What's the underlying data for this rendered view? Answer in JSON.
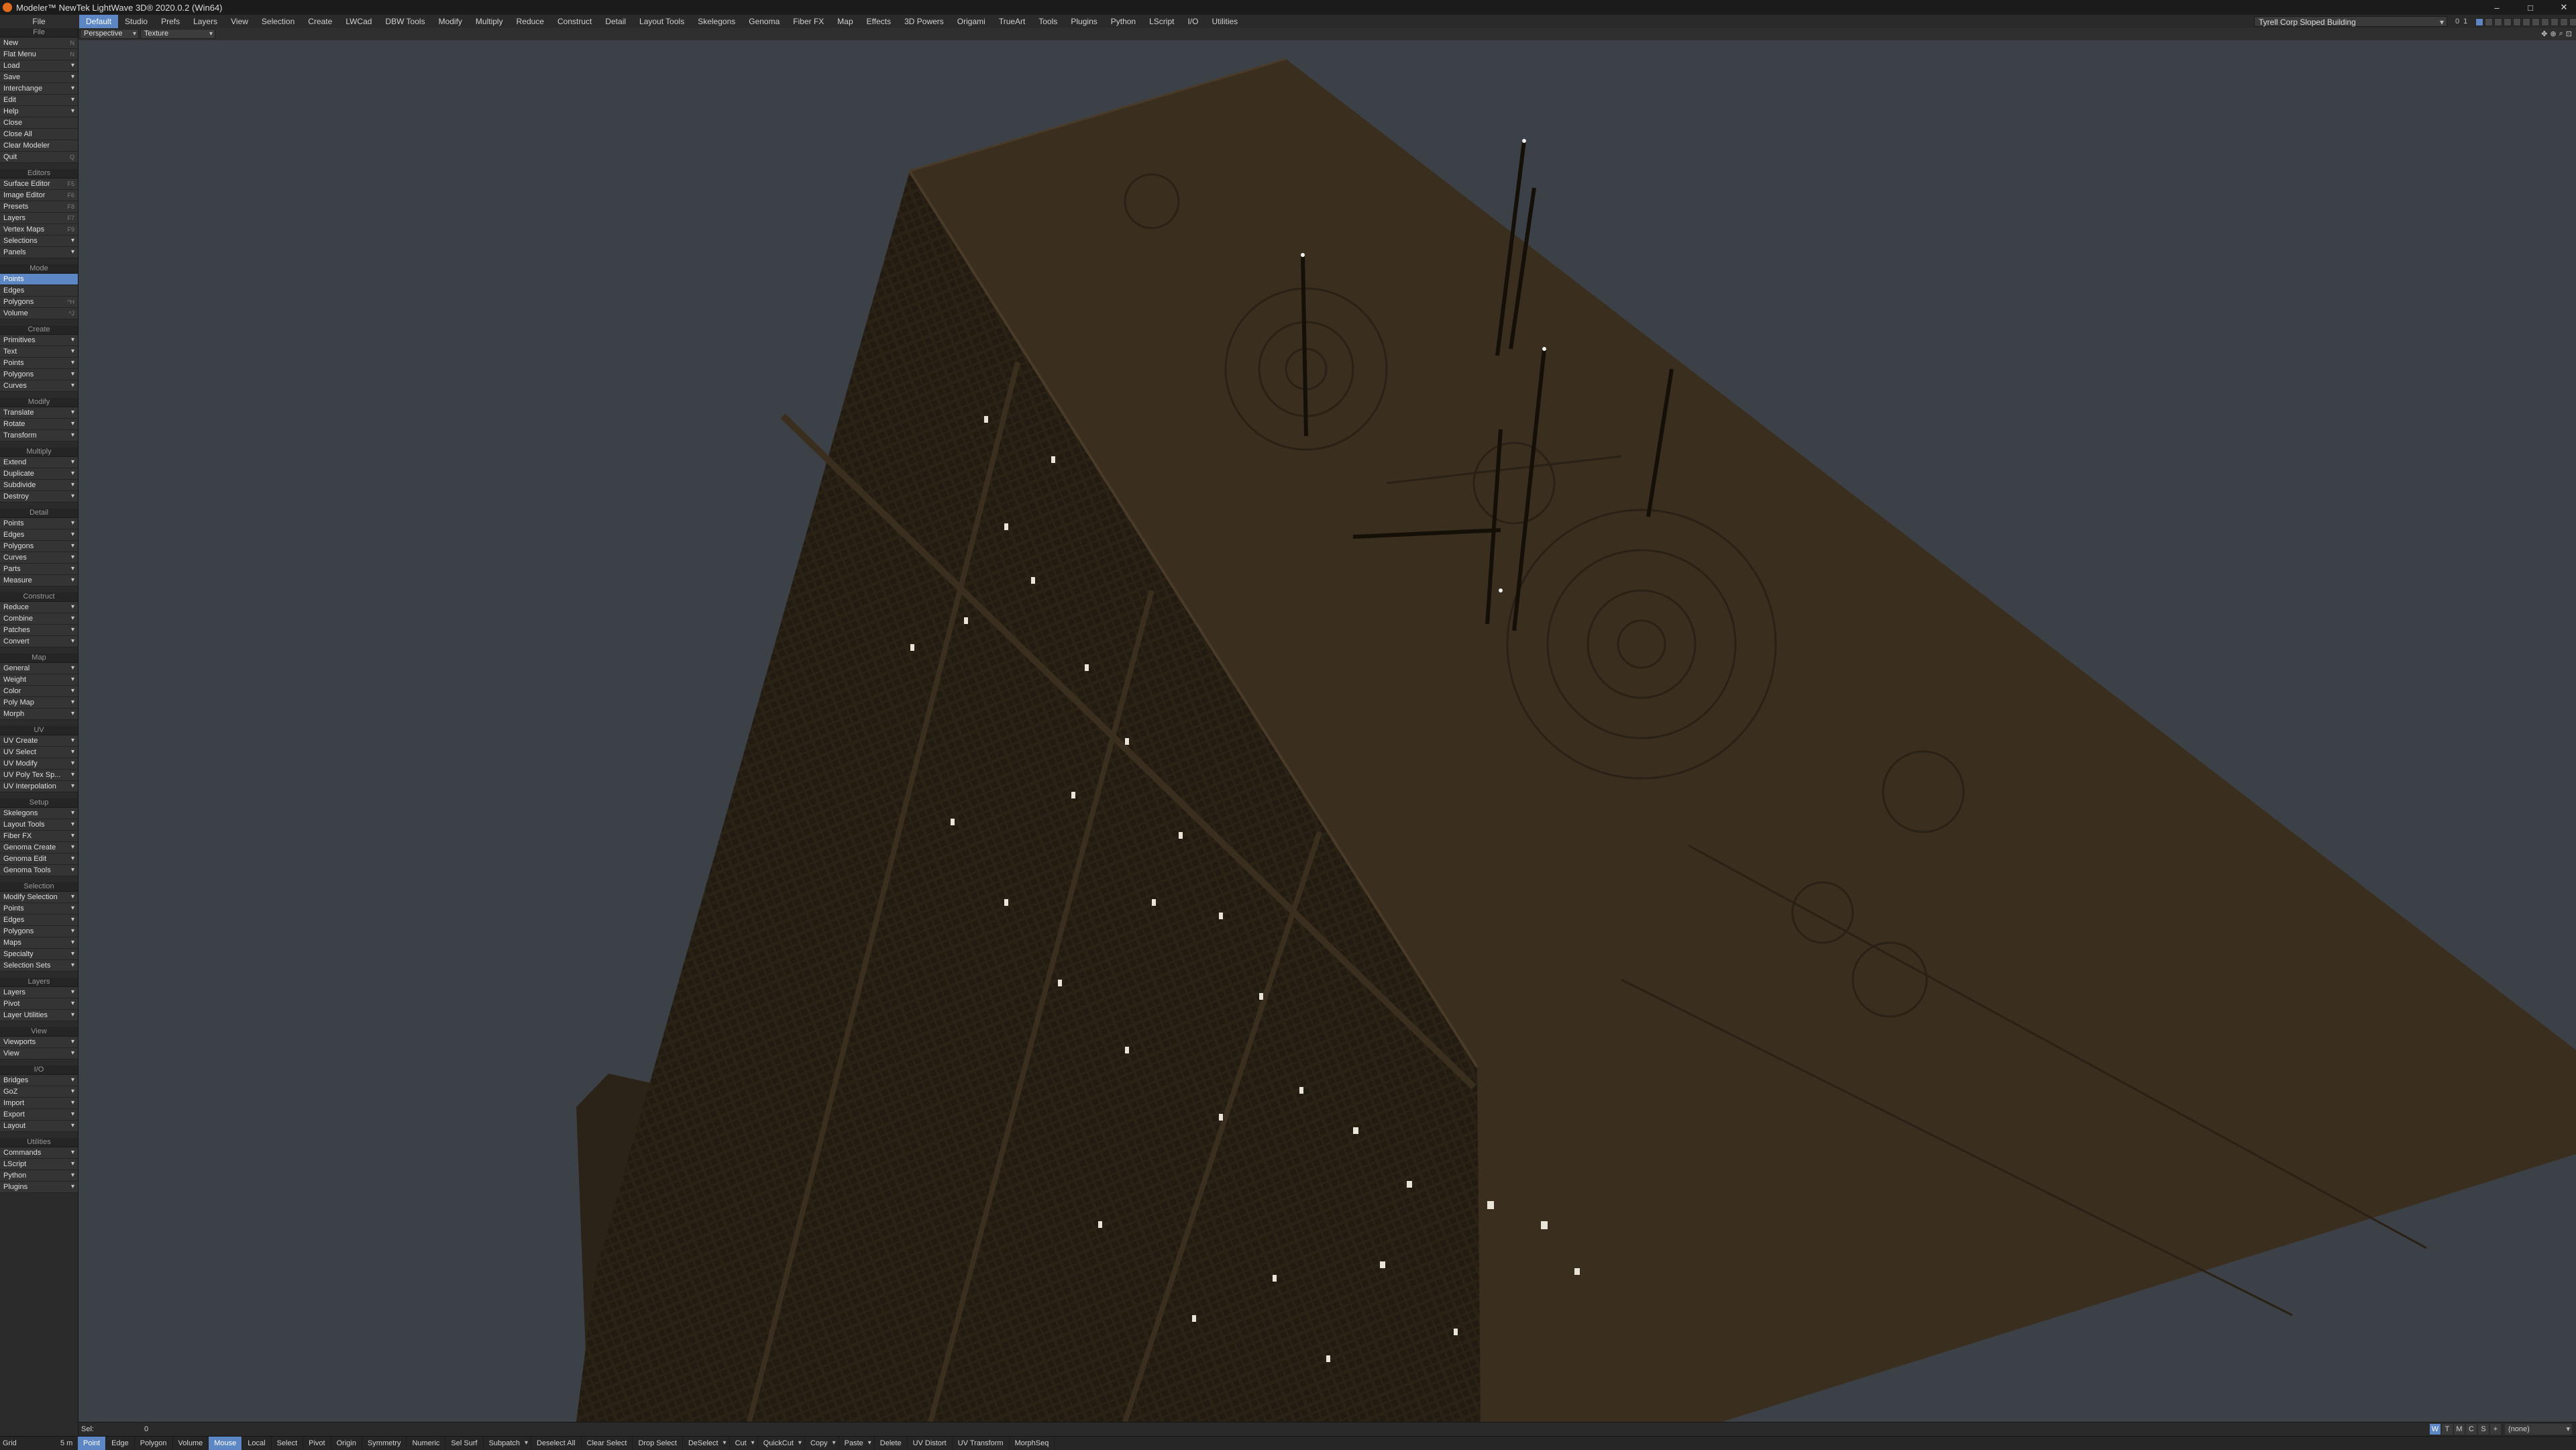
{
  "window": {
    "title": "Modeler™ NewTek LightWave 3D® 2020.0.2 (Win64)",
    "controls": [
      "–",
      "□",
      "✕"
    ]
  },
  "tabs": {
    "file_label": "File",
    "items": [
      "Default",
      "Studio",
      "Prefs",
      "Layers",
      "View",
      "Selection",
      "Create",
      "LWCad",
      "DBW Tools",
      "Modify",
      "Multiply",
      "Reduce",
      "Construct",
      "Detail",
      "Layout Tools",
      "Skelegons",
      "Genoma",
      "Fiber FX",
      "Map",
      "Effects",
      "3D Powers",
      "Origami",
      "TrueArt",
      "Tools",
      "Plugins",
      "Python",
      "LScript",
      "I/O",
      "Utilities"
    ],
    "active": "Default"
  },
  "object_selector": {
    "value": "Tyrell Corp Sloped Building"
  },
  "layer_info": {
    "a": "0",
    "b": "1"
  },
  "sidebar": {
    "file_group": [
      {
        "label": "New",
        "sc": "N"
      },
      {
        "label": "Flat Menu",
        "sc": "N"
      },
      {
        "label": "Load",
        "arrow": true
      },
      {
        "label": "Save",
        "arrow": true
      },
      {
        "label": "Interchange",
        "arrow": true
      },
      {
        "label": "Edit",
        "arrow": true
      },
      {
        "label": "Help",
        "arrow": true
      },
      {
        "label": "Close",
        "sc": ""
      },
      {
        "label": "Close All",
        "sc": ""
      },
      {
        "label": "Clear Modeler",
        "sc": ""
      },
      {
        "label": "Quit",
        "sc": "Q"
      }
    ],
    "groups": [
      {
        "title": "Editors",
        "items": [
          {
            "label": "Surface Editor",
            "sc": "F5"
          },
          {
            "label": "Image Editor",
            "sc": "F6"
          },
          {
            "label": "Presets",
            "sc": "F8"
          },
          {
            "label": "Layers",
            "sc": "F7"
          },
          {
            "label": "Vertex Maps",
            "sc": "F9"
          },
          {
            "label": "Selections",
            "arrow": true
          },
          {
            "label": "Panels",
            "arrow": true
          }
        ]
      },
      {
        "title": "Mode",
        "items": [
          {
            "label": "Points",
            "active": true
          },
          {
            "label": "Edges"
          },
          {
            "label": "Polygons",
            "sc": "^H"
          },
          {
            "label": "Volume",
            "sc": "^J"
          }
        ]
      },
      {
        "title": "Create",
        "items": [
          {
            "label": "Primitives",
            "arrow": true
          },
          {
            "label": "Text",
            "arrow": true
          },
          {
            "label": "Points",
            "arrow": true
          },
          {
            "label": "Polygons",
            "arrow": true
          },
          {
            "label": "Curves",
            "arrow": true
          }
        ]
      },
      {
        "title": "Modify",
        "items": [
          {
            "label": "Translate",
            "arrow": true
          },
          {
            "label": "Rotate",
            "arrow": true
          },
          {
            "label": "Transform",
            "arrow": true
          }
        ]
      },
      {
        "title": "Multiply",
        "items": [
          {
            "label": "Extend",
            "arrow": true
          },
          {
            "label": "Duplicate",
            "arrow": true
          },
          {
            "label": "Subdivide",
            "arrow": true
          },
          {
            "label": "Destroy",
            "arrow": true
          }
        ]
      },
      {
        "title": "Detail",
        "items": [
          {
            "label": "Points",
            "arrow": true
          },
          {
            "label": "Edges",
            "arrow": true
          },
          {
            "label": "Polygons",
            "arrow": true
          },
          {
            "label": "Curves",
            "arrow": true
          },
          {
            "label": "Parts",
            "arrow": true
          },
          {
            "label": "Measure",
            "arrow": true
          }
        ]
      },
      {
        "title": "Construct",
        "items": [
          {
            "label": "Reduce",
            "arrow": true
          },
          {
            "label": "Combine",
            "arrow": true
          },
          {
            "label": "Patches",
            "arrow": true
          },
          {
            "label": "Convert",
            "arrow": true
          }
        ]
      },
      {
        "title": "Map",
        "items": [
          {
            "label": "General",
            "arrow": true
          },
          {
            "label": "Weight",
            "arrow": true
          },
          {
            "label": "Color",
            "arrow": true
          },
          {
            "label": "Poly Map",
            "arrow": true
          },
          {
            "label": "Morph",
            "arrow": true
          }
        ]
      },
      {
        "title": "UV",
        "items": [
          {
            "label": "UV Create",
            "arrow": true
          },
          {
            "label": "UV Select",
            "arrow": true
          },
          {
            "label": "UV Modify",
            "arrow": true
          },
          {
            "label": "UV Poly Tex Sp...",
            "arrow": true
          },
          {
            "label": "UV Interpolation",
            "arrow": true
          }
        ]
      },
      {
        "title": "Setup",
        "items": [
          {
            "label": "Skelegons",
            "arrow": true
          },
          {
            "label": "Layout Tools",
            "arrow": true
          },
          {
            "label": "Fiber FX",
            "arrow": true
          },
          {
            "label": "Genoma Create",
            "arrow": true
          },
          {
            "label": "Genoma Edit",
            "arrow": true
          },
          {
            "label": "Genoma Tools",
            "arrow": true
          }
        ]
      },
      {
        "title": "Selection",
        "items": [
          {
            "label": "Modify Selection",
            "arrow": true
          },
          {
            "label": "Points",
            "arrow": true
          },
          {
            "label": "Edges",
            "arrow": true
          },
          {
            "label": "Polygons",
            "arrow": true
          },
          {
            "label": "Maps",
            "arrow": true
          },
          {
            "label": "Specialty",
            "arrow": true
          },
          {
            "label": "Selection Sets",
            "arrow": true
          }
        ]
      },
      {
        "title": "Layers",
        "items": [
          {
            "label": "Layers",
            "arrow": true
          },
          {
            "label": "Pivot",
            "arrow": true
          },
          {
            "label": "Layer Utilities",
            "arrow": true
          }
        ]
      },
      {
        "title": "View",
        "items": [
          {
            "label": "Viewports",
            "arrow": true
          },
          {
            "label": "View",
            "arrow": true
          }
        ]
      },
      {
        "title": "I/O",
        "items": [
          {
            "label": "Bridges",
            "arrow": true
          },
          {
            "label": "GoZ",
            "arrow": true
          },
          {
            "label": "Import",
            "arrow": true
          },
          {
            "label": "Export",
            "arrow": true
          },
          {
            "label": "Layout",
            "arrow": true
          }
        ]
      },
      {
        "title": "Utilities",
        "items": [
          {
            "label": "Commands",
            "arrow": true
          },
          {
            "label": "LScript",
            "arrow": true
          },
          {
            "label": "Python",
            "arrow": true
          },
          {
            "label": "Plugins",
            "arrow": true
          }
        ]
      }
    ]
  },
  "viewport": {
    "view_mode": "Perspective",
    "shading": "Texture",
    "icons": [
      "✥",
      "⊕",
      "⌕",
      "⊡"
    ],
    "model_color": "#3a2e1e"
  },
  "status_row": {
    "sel_label": "Sel:",
    "sel_count": "0",
    "wtmcs": [
      "W",
      "T",
      "M",
      "C",
      "S",
      "+"
    ],
    "weight_value": "(none)"
  },
  "toolbar": {
    "grid_label": "Grid",
    "grid_value": "5 m",
    "tools": [
      {
        "label": "Point",
        "on": true
      },
      {
        "label": "Edge"
      },
      {
        "label": "Polygon"
      },
      {
        "label": "Volume"
      },
      {
        "label": "Mouse",
        "on": true
      },
      {
        "label": "Local"
      },
      {
        "label": "Select"
      },
      {
        "label": "Pivot"
      },
      {
        "label": "Origin"
      },
      {
        "label": "Symmetry"
      },
      {
        "label": "Numeric"
      },
      {
        "label": "Sel Surf"
      },
      {
        "label": "Subpatch",
        "drop": true
      },
      {
        "label": "Deselect All"
      },
      {
        "label": "Clear Select"
      },
      {
        "label": "Drop Select"
      },
      {
        "label": "DeSelect",
        "drop": true
      },
      {
        "label": "Cut",
        "drop": true
      },
      {
        "label": "QuickCut",
        "drop": true
      },
      {
        "label": "Copy",
        "drop": true
      },
      {
        "label": "Paste",
        "drop": true
      },
      {
        "label": "Delete"
      },
      {
        "label": "UV Distort"
      },
      {
        "label": "UV Transform"
      },
      {
        "label": "MorphSeq"
      }
    ]
  }
}
